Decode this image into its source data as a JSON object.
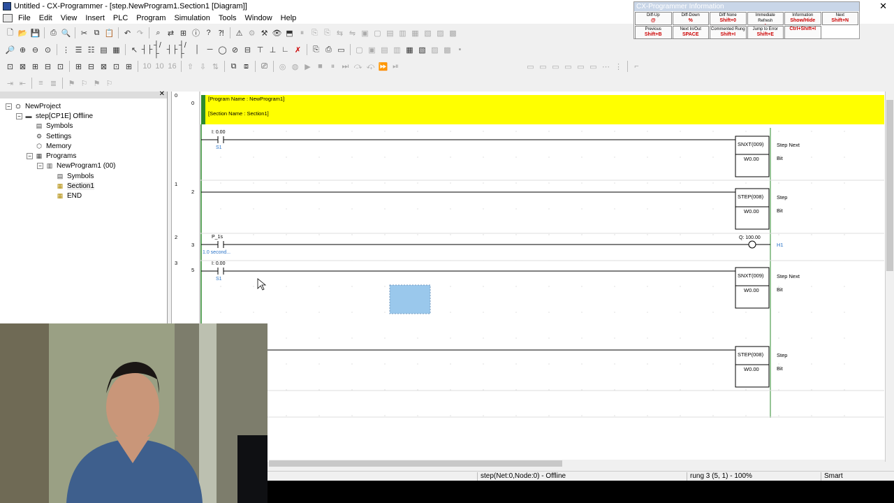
{
  "window": {
    "title": "Untitled - CX-Programmer - [step.NewProgram1.Section1 [Diagram]]",
    "close_glyph": "✕"
  },
  "menu": [
    "File",
    "Edit",
    "View",
    "Insert",
    "PLC",
    "Program",
    "Simulation",
    "Tools",
    "Window",
    "Help"
  ],
  "info_panel": {
    "title": "CX-Programmer Information",
    "cells": [
      {
        "label": "Diff-Up",
        "key": "@"
      },
      {
        "label": "Diff-Down",
        "key": "%"
      },
      {
        "label": "Diff None",
        "key": "Shift+0"
      },
      {
        "label": "Immediate Refresh",
        "key": "!"
      },
      {
        "label": "Information",
        "key": "Show/Hide"
      },
      {
        "label": "Next",
        "key": "Shift+N"
      },
      {
        "label": "Previous",
        "key": "Shift+B"
      },
      {
        "label": "Next In/Out",
        "key": "SPACE"
      },
      {
        "label": "Commented Rung",
        "key": "Shift+I"
      },
      {
        "label": "Jump to Error",
        "key": "Shift+E"
      },
      {
        "label": "",
        "key": "Ctrl+Shift+I"
      }
    ]
  },
  "tree": [
    {
      "label": "NewProject",
      "level": 0,
      "expander": "⊟",
      "icon": "project-icon"
    },
    {
      "label": "step[CP1E] Offline",
      "level": 1,
      "expander": "⊟",
      "icon": "plc-icon"
    },
    {
      "label": "Symbols",
      "level": 2,
      "icon": "symbols-icon"
    },
    {
      "label": "Settings",
      "level": 2,
      "icon": "settings-icon"
    },
    {
      "label": "Memory",
      "level": 2,
      "icon": "memory-icon"
    },
    {
      "label": "Programs",
      "level": 2,
      "expander": "⊟",
      "icon": "programs-icon"
    },
    {
      "label": "NewProgram1 (00)",
      "level": 3,
      "expander": "⊟",
      "icon": "program-icon"
    },
    {
      "label": "Symbols",
      "level": 4,
      "icon": "symbols-icon"
    },
    {
      "label": "Section1",
      "level": 4,
      "icon": "section-icon"
    },
    {
      "label": "END",
      "level": 4,
      "icon": "section-icon"
    }
  ],
  "diagram": {
    "header": {
      "program_name": "[Program Name : NewProgram1]",
      "section_name": "[Section Name : Section1]"
    },
    "rungs": [
      {
        "rung": "0",
        "step": "0"
      },
      {
        "rung": "0",
        "step": "0",
        "contact_addr": "I: 0.00",
        "contact_sym": "S1",
        "instr": "SNXT(009)",
        "operand": "W0.00",
        "comment1": "Step Next",
        "comment2": "Bit"
      },
      {
        "rung": "1",
        "step": "2",
        "instr": "STEP(008)",
        "operand": "W0.00",
        "comment1": "Step",
        "comment2": "Bit"
      },
      {
        "rung": "2",
        "step": "3",
        "contact_addr": "P_1s",
        "contact_sym": "1.0 second...",
        "coil_addr": "Q: 100.00",
        "coil_sym": "H1"
      },
      {
        "rung": "3",
        "step": "5",
        "contact_addr": "I: 0.00",
        "contact_sym": "S1",
        "instr": "SNXT(009)",
        "operand": "W0.00",
        "comment1": "Step Next",
        "comment2": "Bit"
      },
      {
        "instr": "STEP(008)",
        "operand": "W0.00",
        "comment1": "Step",
        "comment2": "Bit"
      }
    ]
  },
  "status": {
    "net": "step(Net:0,Node:0) - Offline",
    "rung": "rung 3 (5, 1) - 100%",
    "mode": "Smart"
  },
  "colors": {
    "header_bar": "#ffff00",
    "rail": "#2e8b2e",
    "selection": "#9ac8ec"
  }
}
